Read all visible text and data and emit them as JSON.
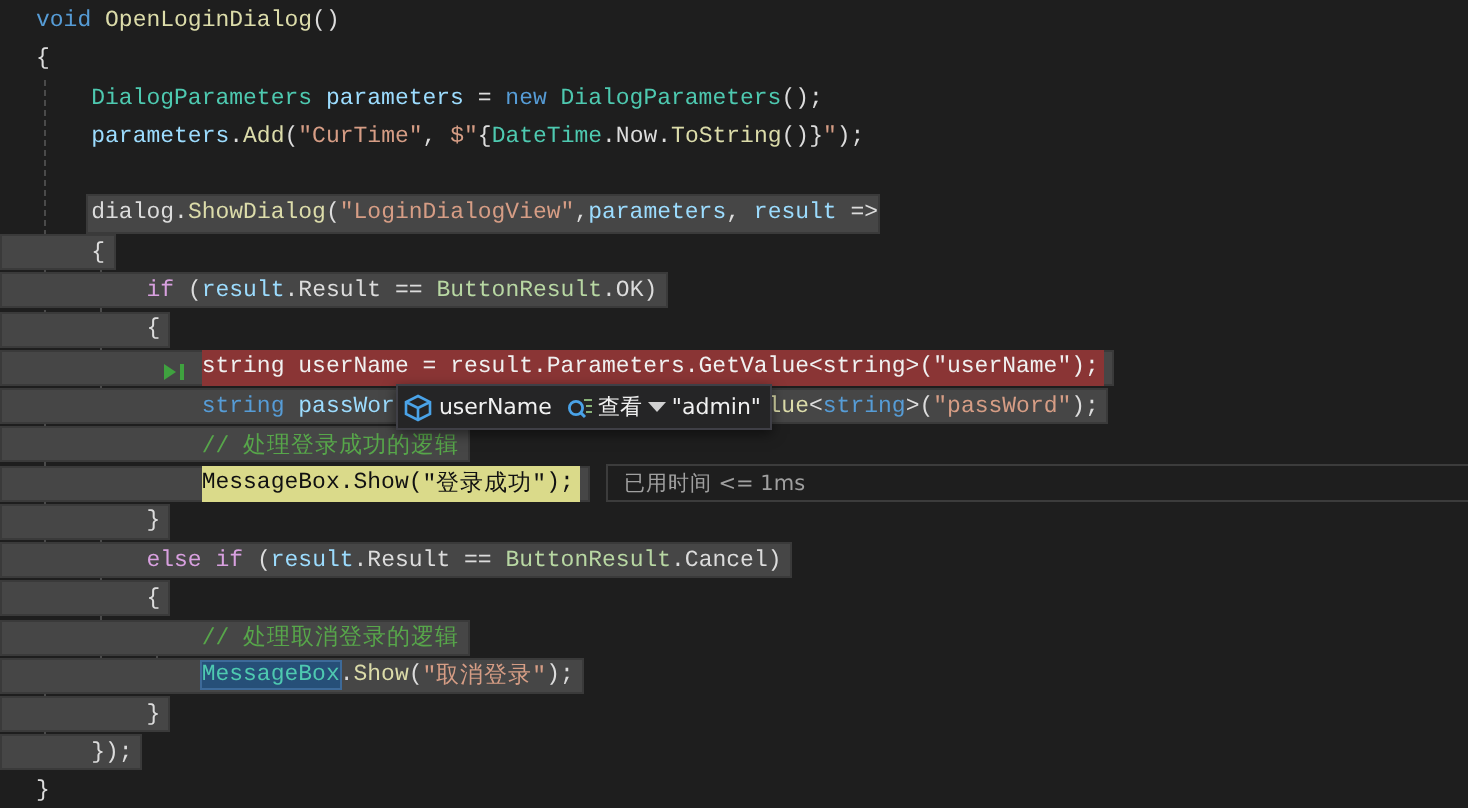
{
  "editor": {
    "lines": [
      {
        "kind": "plain",
        "tokens": [
          {
            "text": "void ",
            "kind": "keyword"
          },
          {
            "text": "OpenLoginDialog",
            "kind": "method"
          },
          {
            "text": "()",
            "kind": "plain"
          }
        ]
      },
      {
        "kind": "plain",
        "tokens": [
          {
            "text": "{",
            "kind": "plain"
          }
        ]
      },
      {
        "kind": "plain",
        "tokens": [
          {
            "text": "    DialogParameters ",
            "kind": "type"
          },
          {
            "text": "parameters",
            "kind": "variable"
          },
          {
            "text": " = ",
            "kind": "plain"
          },
          {
            "text": "new ",
            "kind": "keyword"
          },
          {
            "text": "DialogParameters",
            "kind": "type"
          },
          {
            "text": "();",
            "kind": "plain"
          }
        ]
      },
      {
        "kind": "plain",
        "tokens": [
          {
            "text": "    parameters",
            "kind": "variable"
          },
          {
            "text": ".",
            "kind": "plain"
          },
          {
            "text": "Add",
            "kind": "method"
          },
          {
            "text": "(",
            "kind": "plain"
          },
          {
            "text": "\"CurTime\"",
            "kind": "string"
          },
          {
            "text": ", ",
            "kind": "plain"
          },
          {
            "text": "$\"",
            "kind": "string"
          },
          {
            "text": "{",
            "kind": "plain"
          },
          {
            "text": "DateTime",
            "kind": "type"
          },
          {
            "text": ".Now.",
            "kind": "plain"
          },
          {
            "text": "ToString",
            "kind": "method"
          },
          {
            "text": "()}",
            "kind": "plain"
          },
          {
            "text": "\"",
            "kind": "string"
          },
          {
            "text": ");",
            "kind": "plain"
          }
        ]
      },
      {
        "kind": "plain"
      },
      {
        "kind": "boxed",
        "tokens": [
          {
            "text": "    dialog",
            "kind": "plain"
          },
          {
            "text": ".",
            "kind": "plain"
          },
          {
            "text": "ShowDialog",
            "kind": "method"
          },
          {
            "text": "(",
            "kind": "plain"
          },
          {
            "text": "\"LoginDialogView\"",
            "kind": "string"
          },
          {
            "text": ",",
            "kind": "plain"
          },
          {
            "text": "parameters",
            "kind": "variable"
          },
          {
            "text": ", ",
            "kind": "plain"
          },
          {
            "text": "result",
            "kind": "variable"
          },
          {
            "text": " =>",
            "kind": "plain"
          }
        ]
      },
      {
        "kind": "path",
        "tokens": [
          {
            "text": "    {",
            "kind": "plain"
          }
        ]
      },
      {
        "kind": "path",
        "tokens": [
          {
            "text": "        if",
            "kind": "control"
          },
          {
            "text": " (",
            "kind": "plain"
          },
          {
            "text": "result",
            "kind": "variable"
          },
          {
            "text": ".Result == ",
            "kind": "plain"
          },
          {
            "text": "ButtonResult",
            "kind": "enum"
          },
          {
            "text": ".OK)",
            "kind": "plain"
          }
        ]
      },
      {
        "kind": "path",
        "tokens": [
          {
            "text": "        {",
            "kind": "plain"
          }
        ]
      },
      {
        "kind": "breakpoint",
        "tokens": [
          {
            "text": "            string",
            "kind": "keyword"
          },
          {
            "text": " userName = result.Parameters.GetValue<string>(\"userName\");",
            "kind": "plain"
          }
        ]
      },
      {
        "kind": "path",
        "datatip": {
          "name": "userName",
          "action": "查看",
          "value": "\"admin\""
        },
        "tokens": [
          {
            "text": "            string ",
            "kind": "keyword"
          },
          {
            "text": "passWor",
            "kind": "variable"
          }
        ],
        "tokens_after": [
          {
            "text": "lue",
            "kind": "method"
          },
          {
            "text": "<",
            "kind": "plain"
          },
          {
            "text": "string",
            "kind": "keyword"
          },
          {
            "text": ">(",
            "kind": "plain"
          },
          {
            "text": "\"passWord\"",
            "kind": "string"
          },
          {
            "text": ");",
            "kind": "plain"
          }
        ]
      },
      {
        "kind": "path",
        "tokens": [
          {
            "text": "            // 处理登录成功的逻辑",
            "kind": "comment"
          }
        ]
      },
      {
        "kind": "current",
        "hint": "已用时间 <= 1ms",
        "tokens": [
          {
            "text": "            MessageBox",
            "kind": "type"
          },
          {
            "text": ".",
            "kind": "plain"
          },
          {
            "text": "Show",
            "kind": "method"
          },
          {
            "text": "(",
            "kind": "plain"
          },
          {
            "text": "\"登录成功\"",
            "kind": "string"
          },
          {
            "text": ");",
            "kind": "plain"
          }
        ]
      },
      {
        "kind": "path",
        "tokens": [
          {
            "text": "        }",
            "kind": "plain"
          }
        ]
      },
      {
        "kind": "path",
        "tokens": [
          {
            "text": "        else ",
            "kind": "control"
          },
          {
            "text": "if",
            "kind": "control"
          },
          {
            "text": " (",
            "kind": "plain"
          },
          {
            "text": "result",
            "kind": "variable"
          },
          {
            "text": ".Result == ",
            "kind": "plain"
          },
          {
            "text": "ButtonResult",
            "kind": "enum"
          },
          {
            "text": ".Cancel)",
            "kind": "plain"
          }
        ]
      },
      {
        "kind": "path",
        "tokens": [
          {
            "text": "        {",
            "kind": "plain"
          }
        ]
      },
      {
        "kind": "path",
        "tokens": [
          {
            "text": "            // 处理取消登录的逻辑",
            "kind": "comment"
          }
        ]
      },
      {
        "kind": "path",
        "tokens": [
          {
            "text": "            MessageBox",
            "kind": "selected_type"
          },
          {
            "text": ".",
            "kind": "plain"
          },
          {
            "text": "Show",
            "kind": "method"
          },
          {
            "text": "(",
            "kind": "plain"
          },
          {
            "text": "\"取消登录\"",
            "kind": "string"
          },
          {
            "text": ");",
            "kind": "plain"
          }
        ]
      },
      {
        "kind": "path",
        "tokens": [
          {
            "text": "        }",
            "kind": "plain"
          }
        ]
      },
      {
        "kind": "path",
        "tokens": [
          {
            "text": "    });",
            "kind": "plain"
          }
        ]
      },
      {
        "kind": "plain",
        "tokens": [
          {
            "text": "}",
            "kind": "plain"
          }
        ]
      }
    ]
  }
}
